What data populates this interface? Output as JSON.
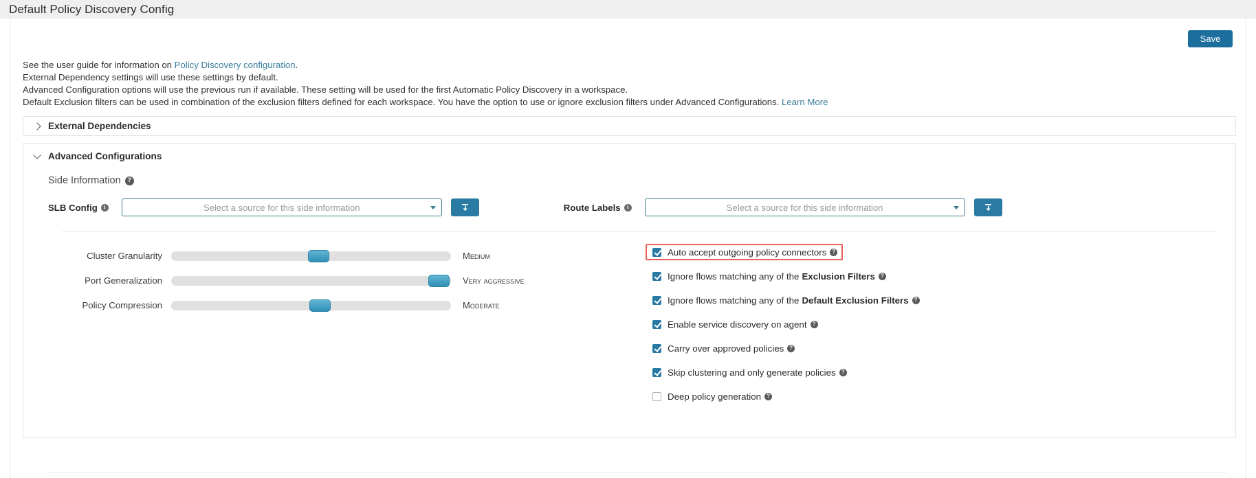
{
  "window": {
    "title": "Default Policy Discovery Config"
  },
  "toolbar": {
    "save_label": "Save"
  },
  "description": {
    "line1_pre": "See the user guide for information on ",
    "line1_link": "Policy Discovery configuration",
    "line1_post": ".",
    "line2": "External Dependency settings will use these settings by default.",
    "line3": "Advanced Configuration options will use the previous run if available. These setting will be used for the first Automatic Policy Discovery in a workspace.",
    "line4_pre": "Default Exclusion filters can be used in combination of the exclusion filters defined for each workspace. You have the option to use or ignore exclusion filters under Advanced Configurations. ",
    "line4_link": "Learn More"
  },
  "accordions": {
    "external_dependencies": {
      "title": "External Dependencies",
      "expanded": false,
      "chevron": "chevron-right-icon"
    },
    "advanced_configurations": {
      "title": "Advanced Configurations",
      "expanded": true,
      "chevron": "chevron-down-icon"
    }
  },
  "side_information": {
    "heading": "Side Information",
    "heading_help": "?",
    "sources": [
      {
        "label": "SLB Config",
        "info_icon": "info-icon",
        "placeholder": "Select a source for this side information",
        "value": "",
        "upload_icon": "upload-icon"
      },
      {
        "label": "Route Labels",
        "info_icon": "info-icon",
        "placeholder": "Select a source for this side information",
        "value": "",
        "upload_icon": "upload-icon"
      }
    ]
  },
  "sliders": [
    {
      "label": "Cluster Granularity",
      "value_text": "Medium",
      "percent": 49
    },
    {
      "label": "Port Generalization",
      "value_text": "Very Aggressive",
      "percent": 96
    },
    {
      "label": "Policy Compression",
      "value_text": "Moderate",
      "percent": 50
    }
  ],
  "checkboxes": [
    {
      "pre": "Auto accept outgoing policy connectors",
      "bold": "",
      "post": "",
      "checked": true,
      "highlighted": true,
      "help": "?"
    },
    {
      "pre": "Ignore flows matching any of the",
      "bold": "Exclusion Filters",
      "post": "",
      "checked": true,
      "highlighted": false,
      "help": "?"
    },
    {
      "pre": "Ignore flows matching any of the",
      "bold": "Default Exclusion Filters",
      "post": "",
      "checked": true,
      "highlighted": false,
      "help": "?"
    },
    {
      "pre": "Enable service discovery on agent",
      "bold": "",
      "post": "",
      "checked": true,
      "highlighted": false,
      "help": "?"
    },
    {
      "pre": "Carry over approved policies",
      "bold": "",
      "post": "",
      "checked": true,
      "highlighted": false,
      "help": "?"
    },
    {
      "pre": "Skip clustering and only generate policies",
      "bold": "",
      "post": "",
      "checked": true,
      "highlighted": false,
      "help": "?"
    },
    {
      "pre": "Deep policy generation",
      "bold": "",
      "post": "",
      "checked": false,
      "highlighted": false,
      "help": "?"
    }
  ],
  "colors": {
    "accent": "#2a7ba3",
    "save_button": "#1c6e9c",
    "link": "#3a7e9c",
    "highlight_border": "#e8625a",
    "slider_thumb": "#2e8fb5",
    "slider_track": "#e0e0e0"
  }
}
